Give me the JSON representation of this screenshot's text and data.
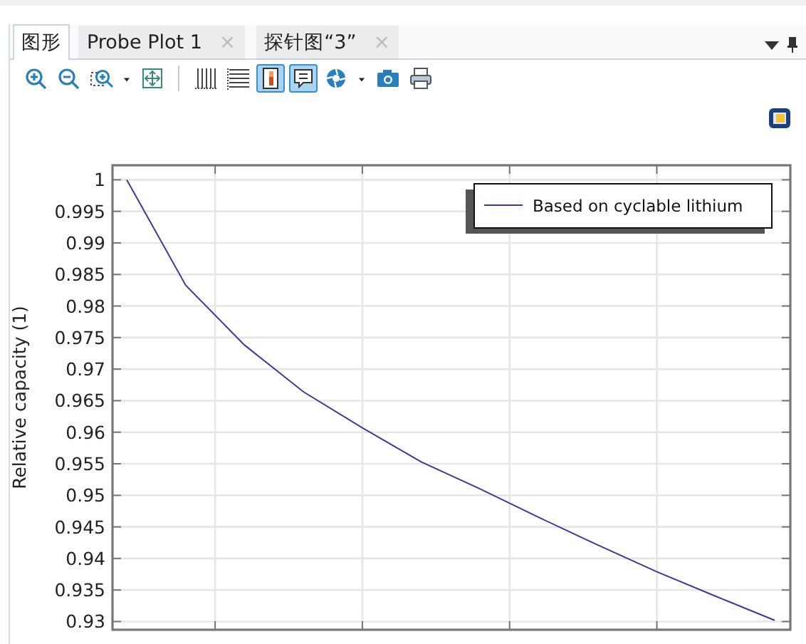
{
  "tabs": [
    {
      "label": "图形",
      "selected": true
    },
    {
      "label": "Probe Plot 1",
      "selected": false,
      "close": "×"
    },
    {
      "label": "探针图“3”",
      "selected": false,
      "close": "×"
    }
  ],
  "toolbar": [
    {
      "kind": "zoom-in",
      "on": false
    },
    {
      "kind": "zoom-out",
      "on": false
    },
    {
      "kind": "zoom-box",
      "on": false
    },
    {
      "kind": "caret",
      "on": false
    },
    {
      "kind": "zoom-extents",
      "on": false
    },
    {
      "kind": "separator"
    },
    {
      "kind": "grid-vertical",
      "on": false
    },
    {
      "kind": "grid-horizontal",
      "on": false
    },
    {
      "kind": "color-legend",
      "on": true
    },
    {
      "kind": "legend",
      "on": true
    },
    {
      "kind": "lights",
      "on": false
    },
    {
      "kind": "caret",
      "on": false
    },
    {
      "kind": "camera",
      "on": false
    },
    {
      "kind": "print",
      "on": false
    }
  ],
  "plot": {
    "chart_data": {
      "type": "line",
      "ylabel": "Relative capacity (1)",
      "categories": [
        null,
        null,
        null,
        null,
        null,
        null,
        null,
        null,
        null,
        null,
        null,
        null
      ],
      "series": [
        {
          "name": "Based on cyclable lithium",
          "color": "#3b3b8f",
          "values": [
            1,
            0.9833,
            0.9738,
            0.9664,
            0.9607,
            0.9553,
            0.951,
            0.9465,
            0.9421,
            0.9379,
            0.934,
            0.9302
          ]
        }
      ],
      "ylim": [
        0.9287,
        1.0023
      ],
      "grid": true,
      "yticks": [
        {
          "value": 0.93,
          "label": "0.93"
        },
        {
          "value": 0.935,
          "label": "0.935"
        },
        {
          "value": 0.94,
          "label": "0.94"
        },
        {
          "value": 0.945,
          "label": "0.945"
        },
        {
          "value": 0.95,
          "label": "0.95"
        },
        {
          "value": 0.955,
          "label": "0.955"
        },
        {
          "value": 0.96,
          "label": "0.96"
        },
        {
          "value": 0.965,
          "label": "0.965"
        },
        {
          "value": 0.97,
          "label": "0.97"
        },
        {
          "value": 0.975,
          "label": "0.975"
        },
        {
          "value": 0.98,
          "label": "0.98"
        },
        {
          "value": 0.985,
          "label": "0.985"
        },
        {
          "value": 0.99,
          "label": "0.99"
        },
        {
          "value": 0.995,
          "label": "0.995"
        },
        {
          "value": 1,
          "label": "1"
        }
      ]
    }
  }
}
